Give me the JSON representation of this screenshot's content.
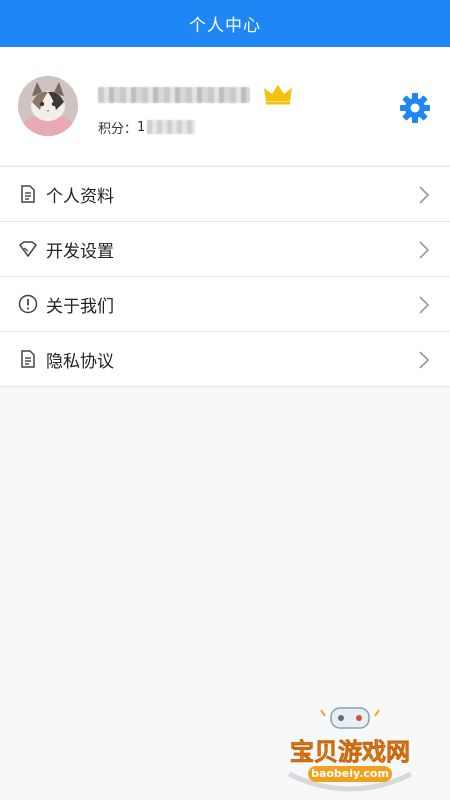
{
  "header": {
    "title": "个人中心"
  },
  "profile": {
    "points_label": "积分：",
    "points_value": "1",
    "crown_color": "#f5c20a",
    "settings_color": "#1f86f5"
  },
  "menu": {
    "items": [
      {
        "label": "个人资料",
        "icon": "document-icon"
      },
      {
        "label": "开发设置",
        "icon": "diamond-icon"
      },
      {
        "label": "关于我们",
        "icon": "info-icon"
      },
      {
        "label": "隐私协议",
        "icon": "document-icon"
      }
    ]
  },
  "watermark": {
    "text": "宝贝游戏网",
    "url": "baobeiy.com"
  },
  "colors": {
    "primary": "#1f86f5",
    "background": "#f7f8fa"
  }
}
